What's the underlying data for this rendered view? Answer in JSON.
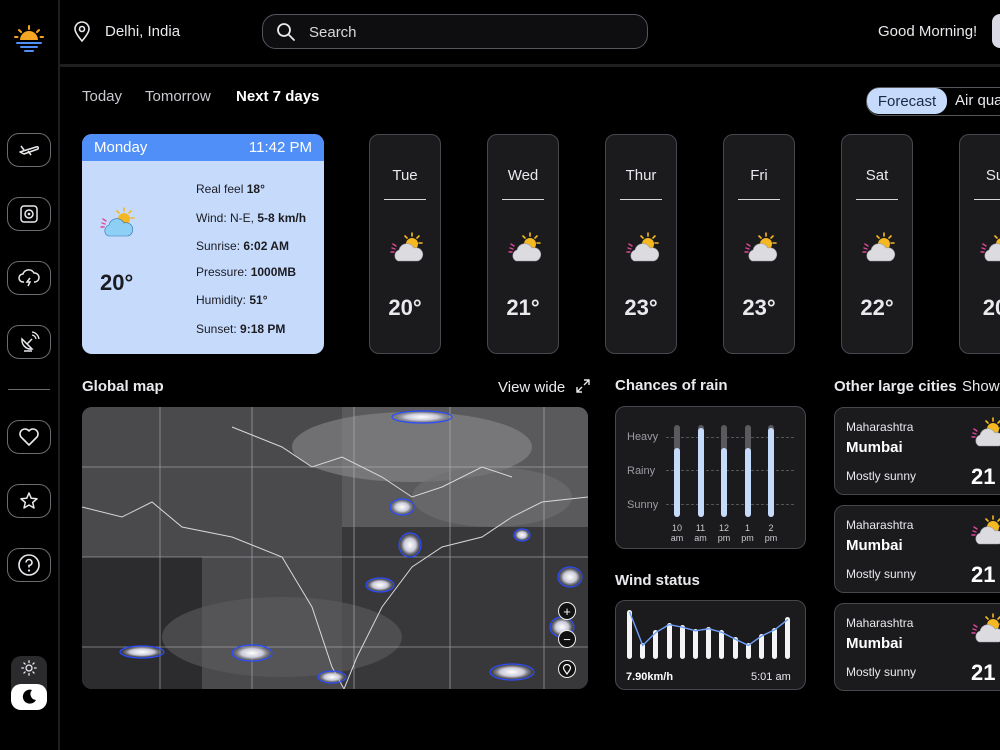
{
  "header": {
    "location": "Delhi, India",
    "search_placeholder": "Search",
    "greeting": "Good Morning!"
  },
  "tabs": {
    "today": "Today",
    "tomorrow": "Tomorrow",
    "next7": "Next 7 days",
    "active": "Next 7 days"
  },
  "view_toggle": {
    "forecast": "Forecast",
    "air": "Air qua"
  },
  "today_card": {
    "day": "Monday",
    "time": "11:42 PM",
    "temp": "20°",
    "real_feel_label": "Real feel",
    "real_feel": "18°",
    "wind_label": "Wind: N-E,",
    "wind": "5-8 km/h",
    "sunrise_label": "Sunrise:",
    "sunrise": "6:02 AM",
    "pressure_label": "Pressure:",
    "pressure": "1000MB",
    "humidity_label": "Humidity:",
    "humidity": "51°",
    "sunset_label": "Sunset:",
    "sunset": "9:18 PM"
  },
  "forecast": [
    {
      "day": "Tue",
      "temp": "20°",
      "icon": "sun-cloud-icon"
    },
    {
      "day": "Wed",
      "temp": "21°",
      "icon": "sun-cloud-icon"
    },
    {
      "day": "Thur",
      "temp": "23°",
      "icon": "sun-cloud-icon"
    },
    {
      "day": "Fri",
      "temp": "23°",
      "icon": "sun-cloud-icon"
    },
    {
      "day": "Sat",
      "temp": "22°",
      "icon": "sun-cloud-icon"
    },
    {
      "day": "Su",
      "temp": "20",
      "icon": "sun-cloud-icon"
    }
  ],
  "map": {
    "title": "Global map",
    "view_wide": "View wide"
  },
  "rain": {
    "title": "Chances of rain",
    "levels": [
      "Heavy",
      "Rainy",
      "Sunny"
    ],
    "times": [
      {
        "h": "10",
        "p": "am",
        "value": 0.75
      },
      {
        "h": "11",
        "p": "am",
        "value": 0.97
      },
      {
        "h": "12",
        "p": "pm",
        "value": 0.75
      },
      {
        "h": "1",
        "p": "pm",
        "value": 0.75
      },
      {
        "h": "2",
        "p": "pm",
        "value": 0.97
      }
    ]
  },
  "wind": {
    "title": "Wind status",
    "speed": "7.90km/h",
    "time": "5:01 am",
    "values": [
      0.95,
      0.3,
      0.55,
      0.7,
      0.65,
      0.58,
      0.62,
      0.55,
      0.42,
      0.3,
      0.48,
      0.6,
      0.8
    ]
  },
  "cities": {
    "title": "Other large cities",
    "show": "Show",
    "items": [
      {
        "state": "Maharashtra",
        "name": "Mumbai",
        "condition": "Mostly sunny",
        "temp": "21"
      },
      {
        "state": "Maharashtra",
        "name": "Mumbai",
        "condition": "Mostly sunny",
        "temp": "21"
      },
      {
        "state": "Maharashtra",
        "name": "Mumbai",
        "condition": "Mostly sunny",
        "temp": "21"
      }
    ]
  },
  "colors": {
    "accent": "#4f8ff7",
    "card_light": "#c6dbfc",
    "background": "#000000"
  }
}
